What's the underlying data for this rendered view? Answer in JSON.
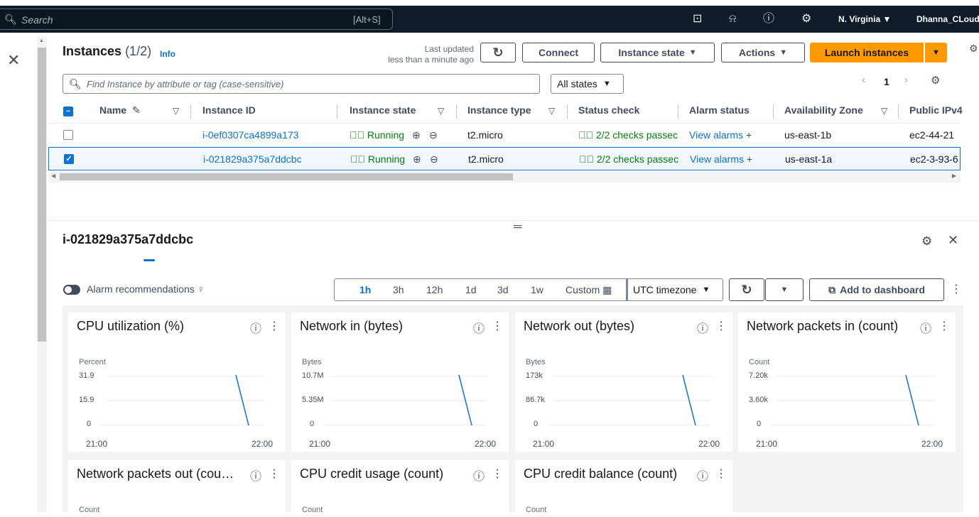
{
  "topbar": {
    "search_placeholder": "Search",
    "search_shortcut": "[Alt+S]",
    "region": "N. Virginia ▼",
    "account": "Dhanna_CLoud"
  },
  "instances": {
    "title": "Instances",
    "count": "(1/2)",
    "info": "Info",
    "last_updated_line1": "Last updated",
    "last_updated_line2": "less than a minute ago",
    "connect": "Connect",
    "instance_state": "Instance state",
    "actions": "Actions",
    "launch": "Launch instances",
    "find_placeholder": "Find Instance by attribute or tag (case-sensitive)",
    "states_filter": "All states",
    "page": "1",
    "columns": [
      "Name",
      "Instance ID",
      "Instance state",
      "Instance type",
      "Status check",
      "Alarm status",
      "Availability Zone",
      "Public IPv4"
    ],
    "rows": [
      {
        "id": "i-0ef0307ca4899a173",
        "state": "Running",
        "type": "t2.micro",
        "status": "2/2 checks passec",
        "alarm": "View alarms",
        "zone": "us-east-1b",
        "dns": "ec2-44-21",
        "selected": false
      },
      {
        "id": "i-021829a375a7ddcbc",
        "state": "Running",
        "type": "t2.micro",
        "status": "2/2 checks passec",
        "alarm": "View alarms",
        "zone": "us-east-1a",
        "dns": "ec2-3-93-6",
        "selected": true
      }
    ]
  },
  "details": {
    "title": "i-021829a375a7ddcbc",
    "alarm_recommendations": "Alarm recommendations",
    "time_ranges": [
      "1h",
      "3h",
      "12h",
      "1d",
      "3d",
      "1w"
    ],
    "active_range": "1h",
    "custom": "Custom",
    "timezone": "UTC timezone",
    "add_to_dashboard": "Add to dashboard"
  },
  "metrics": [
    {
      "title": "CPU utilization (%)",
      "unit": "Percent",
      "yticks": [
        "31.9",
        "15.9",
        "0"
      ],
      "xticks": [
        "21:00",
        "22:00"
      ]
    },
    {
      "title": "Network in (bytes)",
      "unit": "Bytes",
      "yticks": [
        "10.7M",
        "5.35M",
        "0"
      ],
      "xticks": [
        "21:00",
        "22:00"
      ]
    },
    {
      "title": "Network out (bytes)",
      "unit": "Bytes",
      "yticks": [
        "173k",
        "86.7k",
        "0"
      ],
      "xticks": [
        "21:00",
        "22:00"
      ]
    },
    {
      "title": "Network packets in (count)",
      "unit": "Count",
      "yticks": [
        "7.20k",
        "3.60k",
        "0"
      ],
      "xticks": [
        "21:00",
        "22:00"
      ]
    },
    {
      "title": "Network packets out (cou…",
      "unit": "Count"
    },
    {
      "title": "CPU credit usage (count)",
      "unit": "Count"
    },
    {
      "title": "CPU credit balance (count)",
      "unit": "Count"
    }
  ],
  "colors": {
    "accent": "#0972d3",
    "primary": "#ff9900",
    "success": "#037f0c",
    "line": "#0972d3"
  }
}
